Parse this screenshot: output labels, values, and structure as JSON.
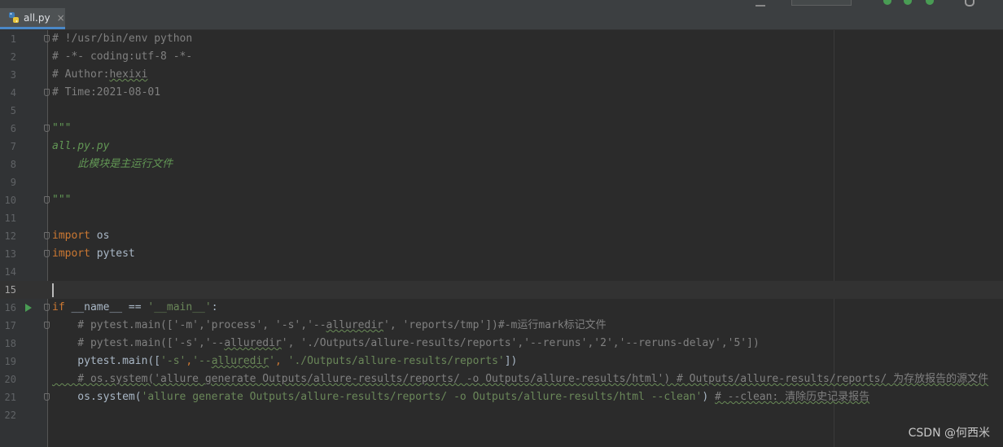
{
  "tab": {
    "filename": "all.py",
    "close": "×",
    "icon": "python-file-icon"
  },
  "watermark": "CSDN @何西米",
  "colors": {
    "background": "#2b2b2b",
    "gutter": "#313335",
    "comment": "#808080",
    "keyword": "#cc7832",
    "string": "#6a8759",
    "docstring": "#629755",
    "text": "#a9b7c6",
    "run_arrow": "#499c54",
    "tab_underline": "#4a88c7"
  },
  "editor": {
    "current_line": 15,
    "run_gutter_line": 16,
    "fold_lines": [
      1,
      4,
      6,
      10,
      12,
      13,
      16,
      17,
      21
    ],
    "lines": [
      {
        "n": "1",
        "tokens": [
          {
            "t": "# !/usr/bin/env python",
            "c": "cmt"
          }
        ]
      },
      {
        "n": "2",
        "tokens": [
          {
            "t": "# -*- coding:utf-8 -*-",
            "c": "cmt"
          }
        ]
      },
      {
        "n": "3",
        "tokens": [
          {
            "t": "# Author:",
            "c": "cmt"
          },
          {
            "t": "hexixi",
            "c": "cmt typo"
          }
        ]
      },
      {
        "n": "4",
        "tokens": [
          {
            "t": "# Time:2021-08-01",
            "c": "cmt"
          }
        ]
      },
      {
        "n": "5",
        "tokens": []
      },
      {
        "n": "6",
        "tokens": [
          {
            "t": "\"\"\"",
            "c": "doc"
          }
        ]
      },
      {
        "n": "7",
        "tokens": [
          {
            "t": "all.py.py",
            "c": "doc"
          }
        ]
      },
      {
        "n": "8",
        "tokens": [
          {
            "t": "    此模块是主运行文件",
            "c": "doc"
          }
        ]
      },
      {
        "n": "9",
        "tokens": []
      },
      {
        "n": "10",
        "tokens": [
          {
            "t": "\"\"\"",
            "c": "doc"
          }
        ]
      },
      {
        "n": "11",
        "tokens": []
      },
      {
        "n": "12",
        "tokens": [
          {
            "t": "import",
            "c": "kw"
          },
          {
            "t": " os",
            "c": ""
          }
        ]
      },
      {
        "n": "13",
        "tokens": [
          {
            "t": "import",
            "c": "kw"
          },
          {
            "t": " pytest",
            "c": ""
          }
        ]
      },
      {
        "n": "14",
        "tokens": []
      },
      {
        "n": "15",
        "tokens": []
      },
      {
        "n": "16",
        "tokens": [
          {
            "t": "if",
            "c": "kw"
          },
          {
            "t": " __name__ == ",
            "c": ""
          },
          {
            "t": "'__main__'",
            "c": "str"
          },
          {
            "t": ":",
            "c": ""
          }
        ]
      },
      {
        "n": "17",
        "tokens": [
          {
            "t": "    # pytest.main(['-m','process', '-s','--",
            "c": "cmt"
          },
          {
            "t": "alluredir",
            "c": "cmt typo"
          },
          {
            "t": "', 'reports/tmp'])#-m运行mark标记文件",
            "c": "cmt"
          }
        ]
      },
      {
        "n": "18",
        "tokens": [
          {
            "t": "    # pytest.main(['-s','--",
            "c": "cmt"
          },
          {
            "t": "alluredir",
            "c": "cmt typo"
          },
          {
            "t": "', './Outputs/allure-results/reports','--reruns','2','--reruns-delay','5'])",
            "c": "cmt"
          }
        ]
      },
      {
        "n": "19",
        "tokens": [
          {
            "t": "    pytest.main([",
            "c": ""
          },
          {
            "t": "'-s'",
            "c": "str"
          },
          {
            "t": ",",
            "c": "kw"
          },
          {
            "t": "'--",
            "c": "str"
          },
          {
            "t": "alluredir",
            "c": "str typo"
          },
          {
            "t": "'",
            "c": "str"
          },
          {
            "t": ", ",
            "c": "kw"
          },
          {
            "t": "'./Outputs/allure-results/reports'",
            "c": "str"
          },
          {
            "t": "])",
            "c": ""
          }
        ]
      },
      {
        "n": "20",
        "tokens": [
          {
            "t": "    # os.system('allure generate Outputs/allure-results/reports/ -o Outputs/allure-results/html') # Outputs/allure-results/reports/ 为存放报告的源文件",
            "c": "cmt typo"
          }
        ]
      },
      {
        "n": "21",
        "tokens": [
          {
            "t": "    os.system(",
            "c": ""
          },
          {
            "t": "'allure generate Outputs/allure-results/reports/ -o Outputs/allure-results/html --clean'",
            "c": "str"
          },
          {
            "t": ") ",
            "c": ""
          },
          {
            "t": "# --clean: 清除历史记录报告",
            "c": "cmt typo"
          }
        ]
      },
      {
        "n": "22",
        "tokens": []
      }
    ]
  }
}
